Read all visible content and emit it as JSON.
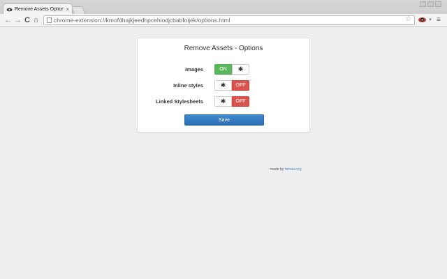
{
  "browser": {
    "tab_title": "Remove Assets Options",
    "tab_close": "×",
    "url": "chrome-extension://kmofdhajkjeedhpcehiodjcbabfoijek/options.html",
    "back_icon": "←",
    "forward_icon": "→",
    "reload_icon": "C",
    "home_icon": "⌂",
    "star_icon": "☆",
    "menu_icon": "≡"
  },
  "options": {
    "title": "Remove Assets - Options",
    "rows": [
      {
        "label": "Images",
        "state": "ON",
        "gear_icon": "✱"
      },
      {
        "label": "Inline styles",
        "state": "OFF",
        "gear_icon": "✱"
      },
      {
        "label": "Linked Stylesheets",
        "state": "OFF",
        "gear_icon": "✱"
      }
    ],
    "save_label": "Save"
  },
  "footer": {
    "prefix": "made by",
    "link": "lisinaia.org"
  },
  "colors": {
    "on": "#5cb85c",
    "off": "#d9534f",
    "primary": "#337ab7",
    "background": "#eeeeee"
  }
}
